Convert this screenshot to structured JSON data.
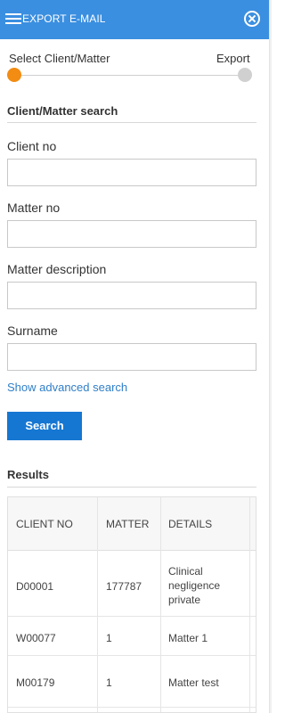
{
  "header": {
    "title": "EXPORT E-MAIL"
  },
  "steps": [
    {
      "label": "Select Client/Matter"
    },
    {
      "label": "Export"
    }
  ],
  "search_section": {
    "title": "Client/Matter search"
  },
  "fields": [
    {
      "label": "Client no",
      "value": ""
    },
    {
      "label": "Matter no",
      "value": ""
    },
    {
      "label": "Matter description",
      "value": ""
    },
    {
      "label": "Surname",
      "value": ""
    }
  ],
  "advanced_link": "Show advanced search",
  "search_button": "Search",
  "results": {
    "title": "Results",
    "columns": [
      "CLIENT NO",
      "MATTER",
      "DETAILS"
    ],
    "rows": [
      {
        "client_no": "D00001",
        "matter": "177787",
        "details": "Clinical negligence private"
      },
      {
        "client_no": "W00077",
        "matter": "1",
        "details": "Matter 1"
      },
      {
        "client_no": "M00179",
        "matter": "1",
        "details": "Matter test"
      }
    ]
  },
  "colors": {
    "header_bg": "#3b8fe0",
    "primary_button": "#1677d2",
    "active_step": "#f28c12",
    "link": "#2f7fc8"
  }
}
